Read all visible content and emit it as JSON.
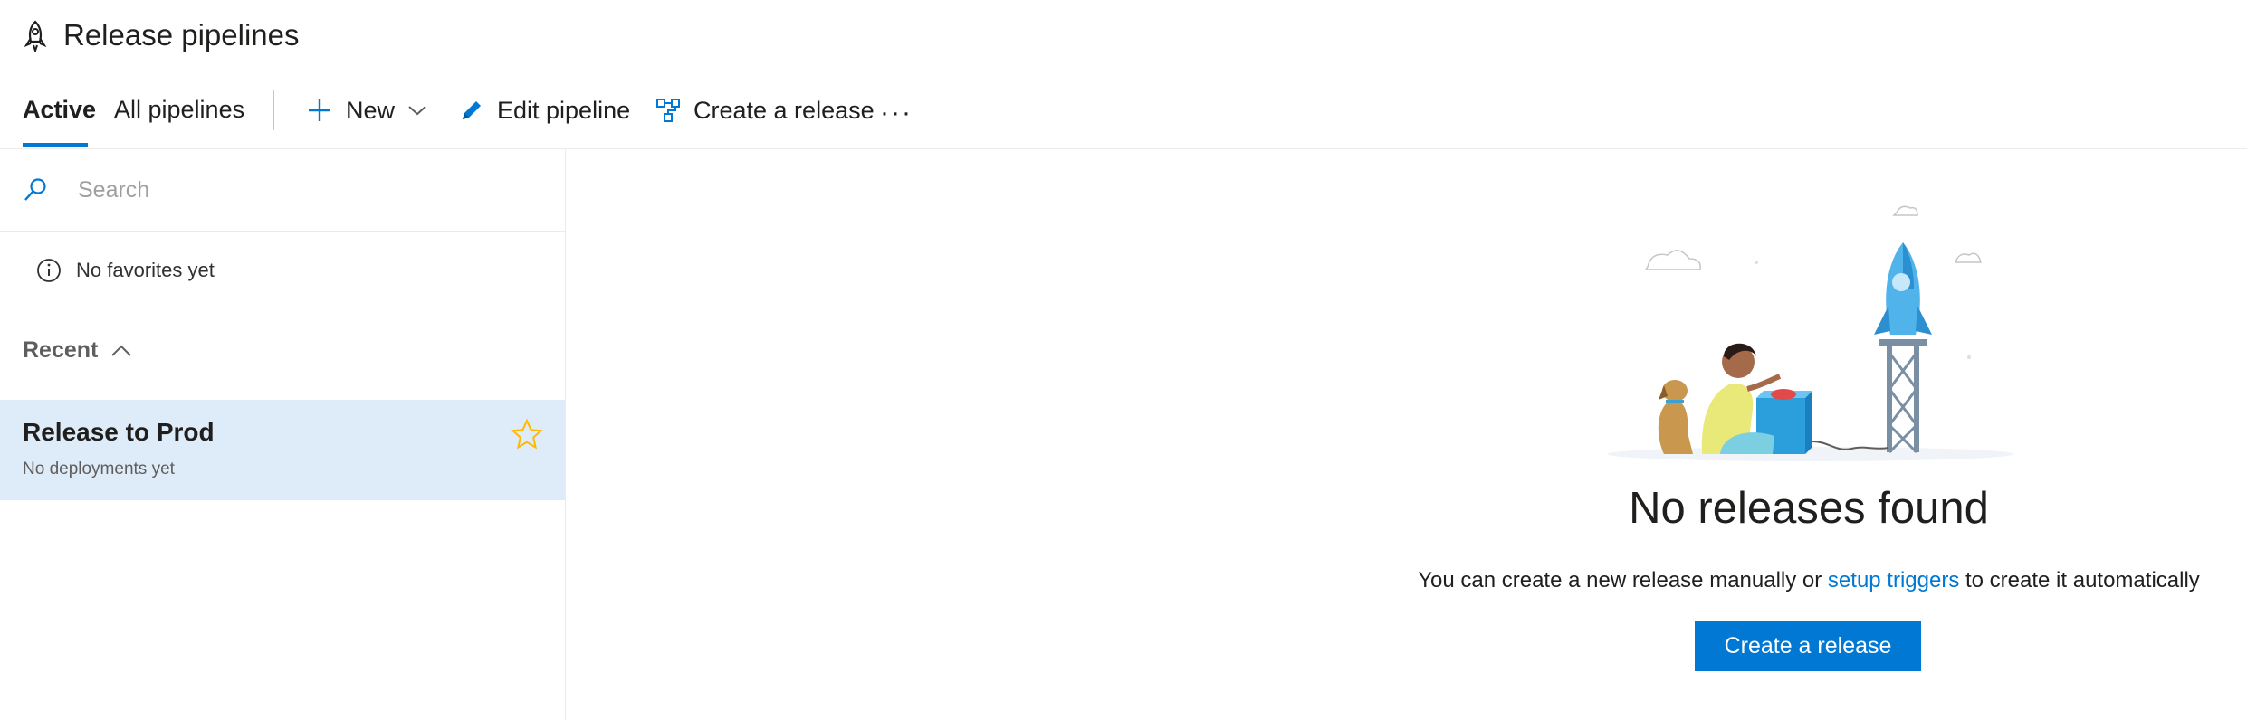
{
  "header": {
    "title": "Release pipelines",
    "icon": "rocket-icon"
  },
  "toolbar": {
    "tabs": [
      {
        "label": "Active",
        "active": true
      },
      {
        "label": "All pipelines",
        "active": false
      }
    ],
    "new_label": "New",
    "edit_label": "Edit pipeline",
    "create_label": "Create a release",
    "more_label": "···"
  },
  "sidebar": {
    "search": {
      "placeholder": "Search",
      "value": ""
    },
    "no_favorites": "No favorites yet",
    "recent_label": "Recent",
    "items": [
      {
        "name": "Release to Prod",
        "subtitle": "No deployments yet",
        "favorite": false
      }
    ]
  },
  "empty_state": {
    "title": "No releases found",
    "message_prefix": "You can create a new release manually or ",
    "message_link": "setup triggers",
    "message_suffix": " to create it automatically",
    "button_label": "Create a release"
  },
  "colors": {
    "accent": "#0078d4",
    "selected_bg": "#deecf9",
    "star": "#ffb900"
  }
}
